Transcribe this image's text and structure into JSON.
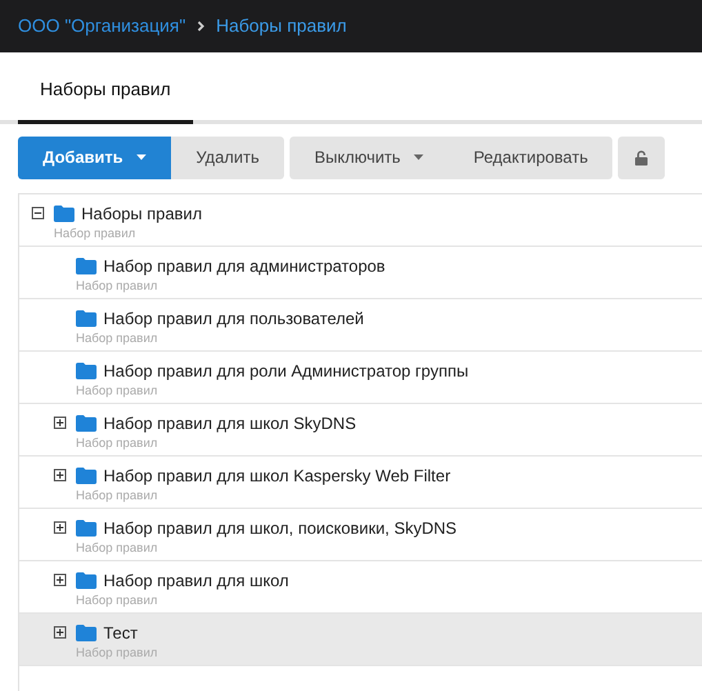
{
  "breadcrumb": [
    {
      "label": "ООО \"Организация\""
    },
    {
      "label": "Наборы правил"
    }
  ],
  "tabs": [
    {
      "label": "Наборы правил",
      "selected": true
    }
  ],
  "toolbar": [
    {
      "buttons": [
        {
          "label": "Добавить",
          "kind": "primary",
          "dropdown": true
        },
        {
          "label": "Удалить",
          "kind": "default",
          "dropdown": false
        }
      ]
    },
    {
      "buttons": [
        {
          "label": "Выключить",
          "kind": "default",
          "dropdown": true
        },
        {
          "label": "Редактировать",
          "kind": "default",
          "dropdown": false
        }
      ]
    },
    {
      "buttons": [
        {
          "kind": "lock"
        }
      ]
    }
  ],
  "tree": [
    {
      "label": "Наборы правил",
      "subtitle": "Набор правил",
      "expandable": true,
      "expanded": true,
      "selected": false,
      "children": [
        {
          "label": "Набор правил для администраторов",
          "subtitle": "Набор правил",
          "expandable": false,
          "selected": false
        },
        {
          "label": "Набор правил для пользователей",
          "subtitle": "Набор правил",
          "expandable": false,
          "selected": false
        },
        {
          "label": "Набор правил для роли Администратор группы",
          "subtitle": "Набор правил",
          "expandable": false,
          "selected": false
        },
        {
          "label": "Набор правил для школ SkyDNS",
          "subtitle": "Набор правил",
          "expandable": true,
          "selected": false
        },
        {
          "label": "Набор правил для школ Kaspersky Web Filter",
          "subtitle": "Набор правил",
          "expandable": true,
          "selected": false
        },
        {
          "label": "Набор правил для школ, поисковики, SkyDNS",
          "subtitle": "Набор правил",
          "expandable": true,
          "selected": false
        },
        {
          "label": "Набор правил для школ",
          "subtitle": "Набор правил",
          "expandable": true,
          "selected": false
        },
        {
          "label": "Тест",
          "subtitle": "Набор правил",
          "expandable": true,
          "selected": true
        }
      ]
    }
  ]
}
